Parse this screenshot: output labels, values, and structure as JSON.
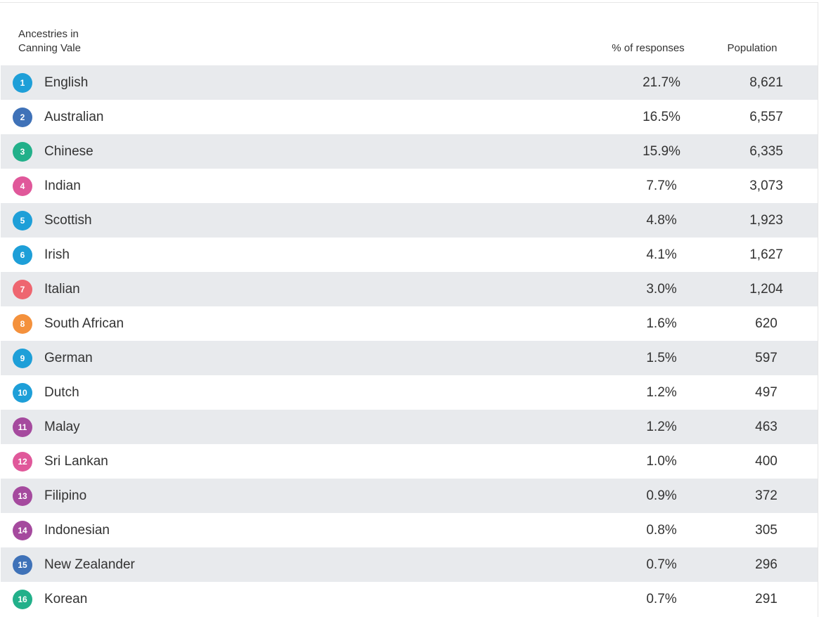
{
  "table": {
    "title": "Ancestries in Canning Vale",
    "columns": {
      "percent": "% of responses",
      "population": "Population"
    },
    "rows": [
      {
        "rank": "1",
        "name": "English",
        "percent": "21.7%",
        "population": "8,621",
        "color": "#1e9fd8"
      },
      {
        "rank": "2",
        "name": "Australian",
        "percent": "16.5%",
        "population": "6,557",
        "color": "#3f72b8"
      },
      {
        "rank": "3",
        "name": "Chinese",
        "percent": "15.9%",
        "population": "6,335",
        "color": "#22b08a"
      },
      {
        "rank": "4",
        "name": "Indian",
        "percent": "7.7%",
        "population": "3,073",
        "color": "#e0589a"
      },
      {
        "rank": "5",
        "name": "Scottish",
        "percent": "4.8%",
        "population": "1,923",
        "color": "#1e9fd8"
      },
      {
        "rank": "6",
        "name": "Irish",
        "percent": "4.1%",
        "population": "1,627",
        "color": "#1e9fd8"
      },
      {
        "rank": "7",
        "name": "Italian",
        "percent": "3.0%",
        "population": "1,204",
        "color": "#ee6670"
      },
      {
        "rank": "8",
        "name": "South African",
        "percent": "1.6%",
        "population": "620",
        "color": "#f4913c"
      },
      {
        "rank": "9",
        "name": "German",
        "percent": "1.5%",
        "population": "597",
        "color": "#1e9fd8"
      },
      {
        "rank": "10",
        "name": "Dutch",
        "percent": "1.2%",
        "population": "497",
        "color": "#1e9fd8"
      },
      {
        "rank": "11",
        "name": "Malay",
        "percent": "1.2%",
        "population": "463",
        "color": "#a54a9e"
      },
      {
        "rank": "12",
        "name": "Sri Lankan",
        "percent": "1.0%",
        "population": "400",
        "color": "#e0589a"
      },
      {
        "rank": "13",
        "name": "Filipino",
        "percent": "0.9%",
        "population": "372",
        "color": "#a54a9e"
      },
      {
        "rank": "14",
        "name": "Indonesian",
        "percent": "0.8%",
        "population": "305",
        "color": "#a54a9e"
      },
      {
        "rank": "15",
        "name": "New Zealander",
        "percent": "0.7%",
        "population": "296",
        "color": "#3f72b8"
      },
      {
        "rank": "16",
        "name": "Korean",
        "percent": "0.7%",
        "population": "291",
        "color": "#22b08a"
      }
    ]
  }
}
